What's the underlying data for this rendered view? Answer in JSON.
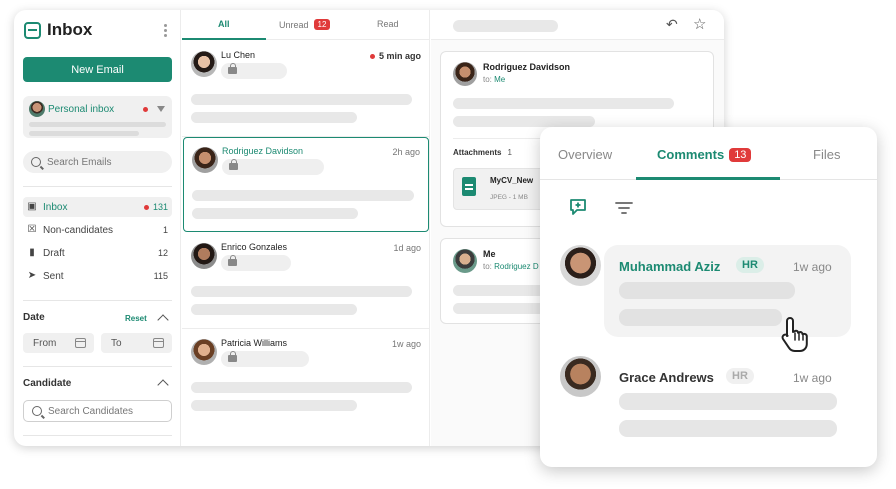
{
  "sidebar": {
    "title": "Inbox",
    "new_email": "New Email",
    "personal_inbox": "Personal inbox",
    "search_placeholder": "Search Emails",
    "nav": [
      {
        "label": "Inbox",
        "count": "131",
        "unread_dot": true
      },
      {
        "label": "Non-candidates",
        "count": "1"
      },
      {
        "label": "Draft",
        "count": "12"
      },
      {
        "label": "Sent",
        "count": "115"
      }
    ],
    "date_section": "Date",
    "reset": "Reset",
    "from": "From",
    "to": "To",
    "candidate_section": "Candidate",
    "search_candidates": "Search Candidates"
  },
  "list": {
    "tabs": [
      {
        "label": "All"
      },
      {
        "label": "Unread",
        "badge": "12"
      },
      {
        "label": "Read"
      }
    ],
    "items": [
      {
        "name": "Lu Chen",
        "time": "5 min ago",
        "unread": true
      },
      {
        "name": "Rodriguez Davidson",
        "time": "2h ago",
        "selected": true
      },
      {
        "name": "Enrico Gonzales",
        "time": "1d ago"
      },
      {
        "name": "Patricia Williams",
        "time": "1w ago"
      }
    ]
  },
  "pane": {
    "card1": {
      "name": "Rodriguez Davidson",
      "to_prefix": "to:",
      "to": "Me"
    },
    "attachments_label": "Attachments",
    "attachments_count": "1",
    "file_name": "MyCV_New",
    "file_meta": "JPEG - 1 MB",
    "card2": {
      "name": "Me",
      "to_prefix": "to:",
      "to": "Rodriguez D"
    }
  },
  "overlay": {
    "tabs": [
      {
        "label": "Overview"
      },
      {
        "label": "Comments",
        "badge": "13"
      },
      {
        "label": "Files"
      }
    ],
    "comments": [
      {
        "name": "Muhammad Aziz",
        "tag": "HR",
        "time": "1w ago"
      },
      {
        "name": "Grace Andrews",
        "tag": "HR",
        "time": "1w ago"
      }
    ]
  },
  "colors": {
    "accent": "#1c8a72",
    "badge": "#e03a3a"
  },
  "icons": [
    "inbox-logo-icon",
    "kebab-icon",
    "search-icon",
    "inbox-icon",
    "close-box-icon",
    "draft-icon",
    "send-icon",
    "calendar-icon",
    "lock-icon",
    "undo-icon",
    "star-icon",
    "file-icon",
    "add-comment-icon",
    "filter-icon",
    "hand-cursor-icon"
  ]
}
